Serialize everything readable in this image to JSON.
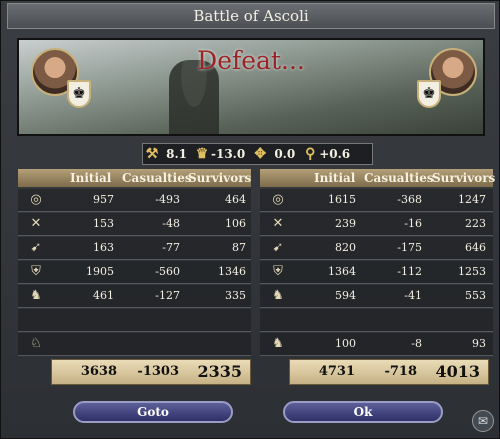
{
  "window": {
    "title": "Battle of Ascoli"
  },
  "banner": {
    "result": "Defeat..."
  },
  "modifiers": [
    {
      "icon": "axes-icon",
      "glyph": "⚒",
      "value": "8.1"
    },
    {
      "icon": "crown-icon",
      "glyph": "♛",
      "value": "-13.0"
    },
    {
      "icon": "tools-icon",
      "glyph": "✥",
      "value": "0.0"
    },
    {
      "icon": "magnifier-icon",
      "glyph": "⚲",
      "value": "+0.6"
    }
  ],
  "columns": {
    "initial": "Initial",
    "casualties": "Casualties",
    "survivors": "Survivors"
  },
  "left": {
    "rows": [
      {
        "unit": "archer-icon",
        "glyph": "◎",
        "initial": "957",
        "casualties": "-493",
        "survivors": "464"
      },
      {
        "unit": "crossed-axes-icon",
        "glyph": "✕",
        "initial": "153",
        "casualties": "-48",
        "survivors": "106"
      },
      {
        "unit": "bow-icon",
        "glyph": "➹",
        "initial": "163",
        "casualties": "-77",
        "survivors": "87"
      },
      {
        "unit": "shield-sword-icon",
        "glyph": "⛨",
        "initial": "1905",
        "casualties": "-560",
        "survivors": "1346"
      },
      {
        "unit": "horse-knight-icon",
        "glyph": "♞",
        "initial": "461",
        "casualties": "-127",
        "survivors": "335"
      },
      {
        "unit": "",
        "glyph": "",
        "initial": "",
        "casualties": "",
        "survivors": ""
      },
      {
        "unit": "elephant-icon",
        "glyph": "♘",
        "initial": "",
        "casualties": "",
        "survivors": ""
      }
    ],
    "totals": {
      "initial": "3638",
      "casualties": "-1303",
      "survivors": "2335"
    }
  },
  "right": {
    "rows": [
      {
        "unit": "archer-icon",
        "glyph": "◎",
        "initial": "1615",
        "casualties": "-368",
        "survivors": "1247"
      },
      {
        "unit": "crossed-axes-icon",
        "glyph": "✕",
        "initial": "239",
        "casualties": "-16",
        "survivors": "223"
      },
      {
        "unit": "bow-icon",
        "glyph": "➹",
        "initial": "820",
        "casualties": "-175",
        "survivors": "646"
      },
      {
        "unit": "shield-sword-icon",
        "glyph": "⛨",
        "initial": "1364",
        "casualties": "-112",
        "survivors": "1253"
      },
      {
        "unit": "horse-knight-icon",
        "glyph": "♞",
        "initial": "594",
        "casualties": "-41",
        "survivors": "553"
      },
      {
        "unit": "",
        "glyph": "",
        "initial": "",
        "casualties": "",
        "survivors": ""
      },
      {
        "unit": "horse-archer-icon",
        "glyph": "♞",
        "initial": "100",
        "casualties": "-8",
        "survivors": "93"
      }
    ],
    "totals": {
      "initial": "4731",
      "casualties": "-718",
      "survivors": "4013"
    }
  },
  "buttons": {
    "goto": "Goto",
    "ok": "Ok"
  }
}
